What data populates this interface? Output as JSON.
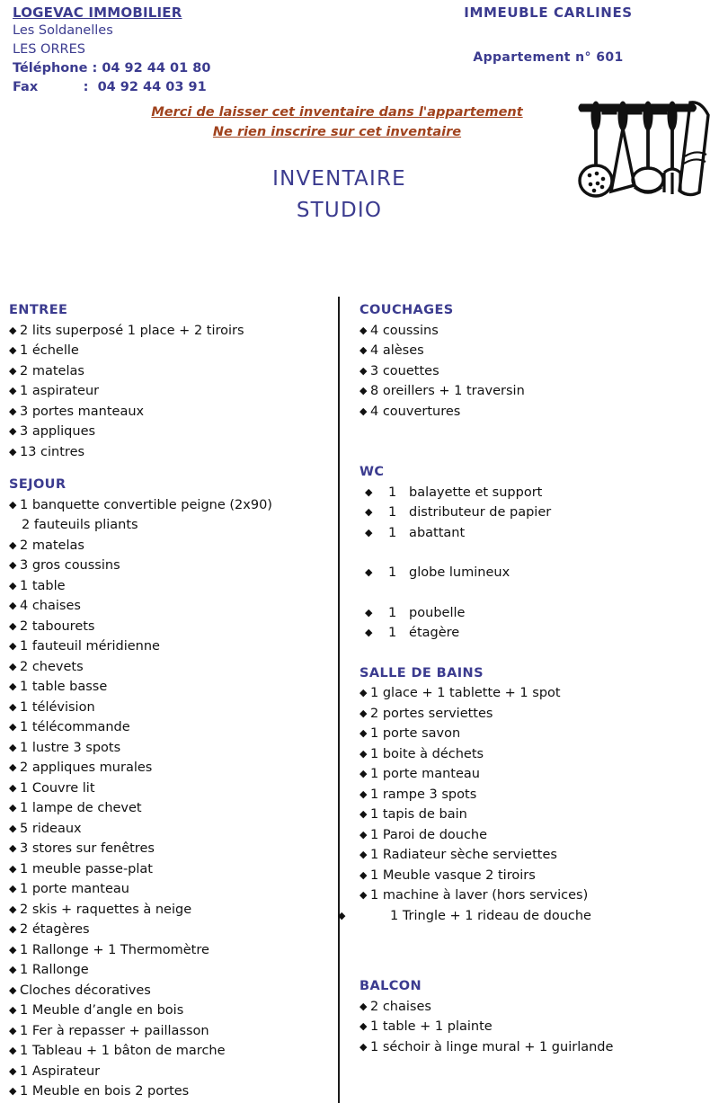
{
  "header": {
    "agency": {
      "name": "LOGEVAC IMMOBILIER",
      "address_line1": "Les Soldanelles",
      "address_line2": "LES ORRES",
      "phone": "Téléphone : 04 92 44 01 80",
      "fax": "Fax          :  04 92 44 03 91"
    },
    "building": {
      "name": "IMMEUBLE CARLINES",
      "apartment": "Appartement n° 601"
    },
    "illustration_name": "kitchen-utensils-drawing"
  },
  "notice": {
    "line1": "Merci de laisser cet inventaire dans l'appartement",
    "line2": "Ne rien inscrire sur cet inventaire"
  },
  "title": {
    "line1": "INVENTAIRE",
    "line2": "STUDIO"
  },
  "colors": {
    "heading_blue": "#3b3b8f",
    "notice_brown": "#a0421d",
    "body_black": "#111111"
  },
  "bullet_glyph": "◆",
  "left_column": [
    {
      "title": "ENTREE",
      "style": "normal",
      "items": [
        {
          "text": "2 lits superposé 1 place + 2 tiroirs",
          "bullet": true
        },
        {
          "text": "1 échelle",
          "bullet": true
        },
        {
          "text": "2 matelas",
          "bullet": true
        },
        {
          "text": "1 aspirateur",
          "bullet": true
        },
        {
          "text": "3 portes manteaux",
          "bullet": true
        },
        {
          "text": "3 appliques",
          "bullet": true
        },
        {
          "text": "13 cintres",
          "bullet": true
        }
      ]
    },
    {
      "title": "SEJOUR",
      "style": "normal",
      "items": [
        {
          "text": "1 banquette convertible peigne (2x90)",
          "bullet": true
        },
        {
          "text": "2 fauteuils pliants",
          "bullet": false
        },
        {
          "text": "2 matelas",
          "bullet": true
        },
        {
          "text": "3 gros coussins",
          "bullet": true
        },
        {
          "text": "1 table",
          "bullet": true
        },
        {
          "text": "4 chaises",
          "bullet": true
        },
        {
          "text": "2 tabourets",
          "bullet": true
        },
        {
          "text": "1 fauteuil méridienne",
          "bullet": true
        },
        {
          "text": "2 chevets",
          "bullet": true
        },
        {
          "text": "1 table basse",
          "bullet": true
        },
        {
          "text": "1 télévision",
          "bullet": true
        },
        {
          "text": "1 télécommande",
          "bullet": true
        },
        {
          "text": "1 lustre 3 spots",
          "bullet": true
        },
        {
          "text": "2 appliques murales",
          "bullet": true
        },
        {
          "text": "1 Couvre lit",
          "bullet": true
        },
        {
          "text": "1 lampe de chevet",
          "bullet": true
        },
        {
          "text": "5 rideaux",
          "bullet": true
        },
        {
          "text": "3 stores sur fenêtres",
          "bullet": true
        },
        {
          "text": "1 meuble passe-plat",
          "bullet": true
        },
        {
          "text": "1 porte manteau",
          "bullet": true
        },
        {
          "text": "2 skis + raquettes à neige",
          "bullet": true
        },
        {
          "text": "2 étagères",
          "bullet": true
        },
        {
          "text": "1 Rallonge + 1 Thermomètre",
          "bullet": true
        },
        {
          "text": "1 Rallonge",
          "bullet": true
        },
        {
          "text": "Cloches décoratives",
          "bullet": true
        },
        {
          "text": "1 Meuble d’angle en bois",
          "bullet": true
        },
        {
          "text": "1 Fer à repasser + paillasson",
          "bullet": true
        },
        {
          "text": "1 Tableau + 1 bâton de marche",
          "bullet": true
        },
        {
          "text": "1 Aspirateur",
          "bullet": true
        },
        {
          "text": "1 Meuble en bois 2 portes",
          "bullet": true
        }
      ]
    }
  ],
  "right_column": [
    {
      "title": "COUCHAGES",
      "style": "normal",
      "items": [
        {
          "text": "4 coussins",
          "bullet": true
        },
        {
          "text": "4 alèses",
          "bullet": true
        },
        {
          "text": "3 couettes",
          "bullet": true
        },
        {
          "text": "8 oreillers + 1 traversin",
          "bullet": true
        },
        {
          "text": "4 couvertures",
          "bullet": true
        }
      ]
    },
    {
      "title": "WC",
      "style": "wide",
      "items": [
        {
          "text": "1   balayette et support",
          "bullet": true
        },
        {
          "text": "1   distributeur de papier",
          "bullet": true
        },
        {
          "text": "1   abattant",
          "bullet": true
        },
        {
          "text": "1   globe lumineux",
          "bullet": true,
          "gap_before": true
        },
        {
          "text": "1   poubelle",
          "bullet": true,
          "gap_before": true
        },
        {
          "text": "1   étagère",
          "bullet": true
        }
      ]
    },
    {
      "title": "SALLE DE BAINS",
      "style": "normal",
      "items": [
        {
          "text": "1 glace + 1 tablette + 1 spot",
          "bullet": true
        },
        {
          "text": "2 portes serviettes",
          "bullet": true
        },
        {
          "text": "1 porte savon",
          "bullet": true
        },
        {
          "text": "1 boite à déchets",
          "bullet": true
        },
        {
          "text": "1 porte manteau",
          "bullet": true
        },
        {
          "text": "1 rampe 3 spots",
          "bullet": true
        },
        {
          "text": "1 tapis de bain",
          "bullet": true
        },
        {
          "text": "1 Paroi de douche",
          "bullet": true
        },
        {
          "text": "1 Radiateur sèche serviettes",
          "bullet": true
        },
        {
          "text": "1 Meuble vasque 2 tiroirs",
          "bullet": true
        },
        {
          "text": "1 machine à laver (hors services)",
          "bullet": true
        },
        {
          "text": "1 Tringle + 1 rideau de douche",
          "bullet": true,
          "outdent": true
        }
      ]
    },
    {
      "title": "BALCON",
      "style": "normal",
      "items": [
        {
          "text": "2 chaises",
          "bullet": true
        },
        {
          "text": "1 table + 1 plainte",
          "bullet": true
        },
        {
          "text": "1 séchoir à linge mural + 1 guirlande",
          "bullet": true
        }
      ]
    }
  ]
}
